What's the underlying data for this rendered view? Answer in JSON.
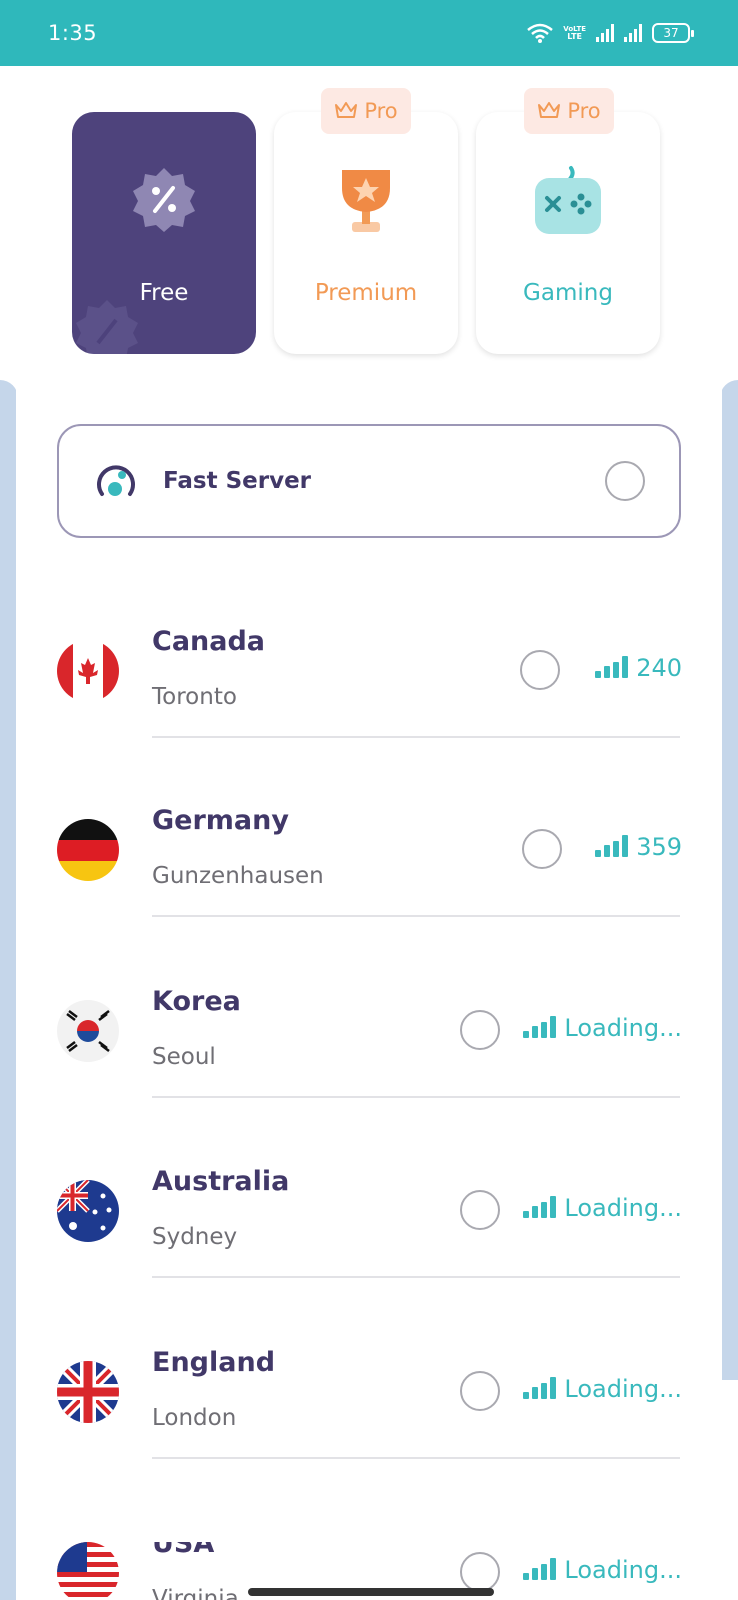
{
  "status_bar": {
    "time": "1:35",
    "volte_top": "VoLTE",
    "volte_bottom": "LTE",
    "battery": "37"
  },
  "categories": [
    {
      "label": "Free",
      "icon": "percent-badge-icon"
    },
    {
      "label": "Premium",
      "icon": "trophy-icon",
      "badge": "Pro"
    },
    {
      "label": "Gaming",
      "icon": "gamepad-icon",
      "badge": "Pro"
    }
  ],
  "fast_server": {
    "label": "Fast Server"
  },
  "servers": [
    {
      "country": "Canada",
      "city": "Toronto",
      "ping": "240"
    },
    {
      "country": "Germany",
      "city": "Gunzenhausen",
      "ping": "359"
    },
    {
      "country": "Korea",
      "city": "Seoul",
      "ping": "Loading..."
    },
    {
      "country": "Australia",
      "city": "Sydney",
      "ping": "Loading..."
    },
    {
      "country": "England",
      "city": "London",
      "ping": "Loading..."
    },
    {
      "country": "USA",
      "city": "Virginia",
      "ping": "Loading..."
    }
  ],
  "colors": {
    "status_bar": "#2fb8bb",
    "accent_purple": "#4e437c",
    "premium_orange": "#f29a55",
    "gaming_teal": "#39b9bd"
  }
}
